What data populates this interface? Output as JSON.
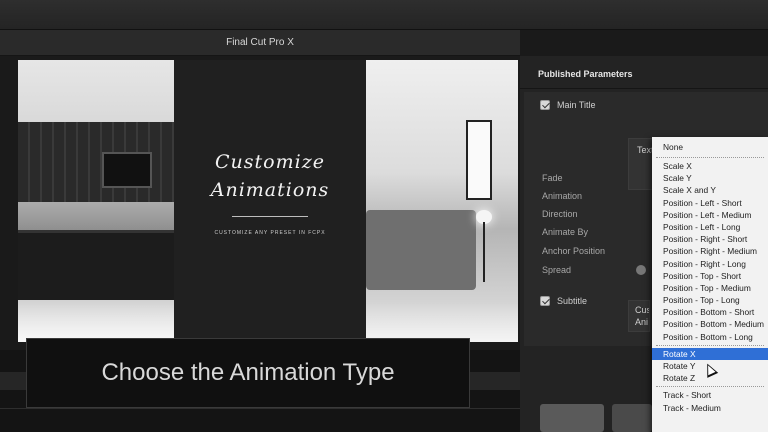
{
  "app": {
    "window_title": "Final Cut Pro X"
  },
  "viewer": {
    "title_lines": [
      "Customize",
      "Animations"
    ],
    "subtitle": "CUSTOMIZE ANY PRESET IN FCPX"
  },
  "caption": "Choose the Animation Type",
  "inspector": {
    "header": "Published Parameters",
    "main_title_label": "Main Title",
    "text_animation_controls": "Text Animation Controls",
    "params": [
      "Fade",
      "Animation",
      "Direction",
      "Animate By",
      "Anchor Position",
      "Spread"
    ],
    "subtitle_label": "Subtitle",
    "subtitle_popup": "Cus\nAni"
  },
  "menu": {
    "none_label": "None",
    "group1": [
      "Scale X",
      "Scale Y",
      "Scale X and Y",
      "Position - Left - Short",
      "Position - Left - Medium",
      "Position - Left - Long",
      "Position - Right - Short",
      "Position - Right - Medium",
      "Position - Right - Long",
      "Position - Top - Short",
      "Position - Top - Medium",
      "Position - Top - Long",
      "Position - Bottom - Short",
      "Position - Bottom - Medium",
      "Position - Bottom - Long"
    ],
    "group2": [
      "Rotate X",
      "Rotate Y",
      "Rotate Z"
    ],
    "group3": [
      "Track - Short",
      "Track - Medium"
    ],
    "selected": "Rotate X"
  },
  "colors": {
    "menu_highlight": "#2f6fd6",
    "menu_bg": "#f2f2f2"
  }
}
